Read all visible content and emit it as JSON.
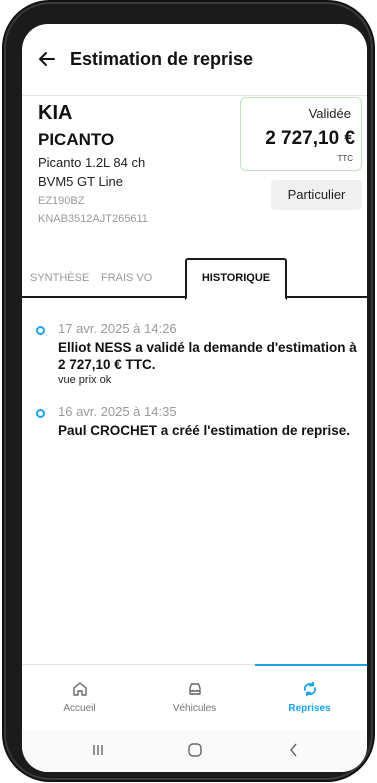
{
  "header": {
    "title": "Estimation de reprise"
  },
  "vehicle": {
    "brand": "KIA",
    "model": "PICANTO",
    "spec_line1": "Picanto 1.2L 84 ch",
    "spec_line2": "BVM5 GT Line",
    "plate": "EZ190BZ",
    "vin": "KNAB3512AJT265611"
  },
  "estimate": {
    "status": "Validée",
    "price": "2 727,10 €",
    "tax_label": "TTC",
    "customer_type": "Particulier",
    "status_color": "#bfe3c2"
  },
  "tabs": [
    {
      "label": "SYNTHÈSE"
    },
    {
      "label": "FRAIS VO"
    },
    {
      "label": "HISTORIQUE"
    }
  ],
  "history": [
    {
      "date": "17 avr. 2025 à 14:26",
      "text": "Elliot NESS a validé la demande d'estimation à 2 727,10 € TTC.",
      "note": "vue prix ok"
    },
    {
      "date": "16 avr. 2025 à 14:35",
      "text": "Paul CROCHET a créé l'estimation de reprise."
    }
  ],
  "bottom_nav": [
    {
      "label": "Accueil",
      "icon": "home-icon"
    },
    {
      "label": "Véhicules",
      "icon": "car-icon"
    },
    {
      "label": "Reprises",
      "icon": "sync-icon"
    }
  ],
  "colors": {
    "accent": "#1aa3e8"
  }
}
